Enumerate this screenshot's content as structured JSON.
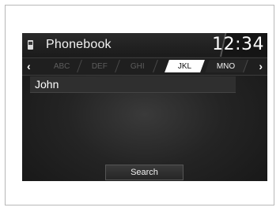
{
  "header": {
    "title": "Phonebook",
    "time": "12:34"
  },
  "tabs": [
    {
      "label": "ABC",
      "state": "dim"
    },
    {
      "label": "DEF",
      "state": "dim"
    },
    {
      "label": "GHI",
      "state": "dim"
    },
    {
      "label": "JKL",
      "state": "active"
    },
    {
      "label": "MNO",
      "state": "normal"
    }
  ],
  "nav": {
    "prev": "‹",
    "next": "›"
  },
  "contacts": [
    {
      "name": "John"
    }
  ],
  "actions": {
    "search_label": "Search"
  },
  "icons": {
    "title_icon": "phone-icon"
  }
}
